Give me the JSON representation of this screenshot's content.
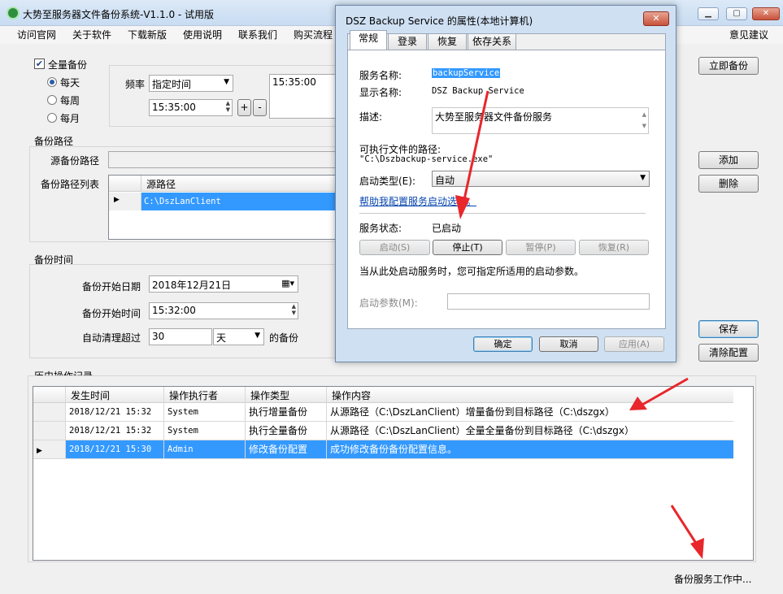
{
  "window": {
    "title": "大势至服务器文件备份系统-V1.1.0 - 试用版",
    "controls": {
      "minimize": "▁",
      "maximize": "▢",
      "close": "✕"
    }
  },
  "menu": {
    "items": [
      "访问官网",
      "关于软件",
      "下载新版",
      "使用说明",
      "联系我们",
      "购买流程"
    ],
    "feedback": "意见建议"
  },
  "schedule": {
    "full_backup_label": "全量备份",
    "full_backup_checked": true,
    "options": [
      "每天",
      "每周",
      "每月"
    ],
    "selected_option": "每天",
    "freq_label": "频率",
    "freq_value": "指定时间",
    "time_value": "15:35:00",
    "plus": "+",
    "minus": "-",
    "times_list": [
      "15:35:00"
    ]
  },
  "paths": {
    "section_label": "备份路径",
    "source_label": "源备份路径",
    "source_value": "",
    "list_label": "备份路径列表",
    "col_header": "源路径",
    "rows": [
      "C:\\DszLanClient"
    ]
  },
  "backup_time": {
    "section_label": "备份时间",
    "start_date_label": "备份开始日期",
    "start_date_value": "2018年12月21日",
    "start_time_label": "备份开始时间",
    "start_time_value": "15:32:00",
    "cleanup_label": "自动清理超过",
    "cleanup_value": "30",
    "cleanup_unit": "天",
    "cleanup_suffix": "的备份"
  },
  "buttons": {
    "backup_now": "立即备份",
    "add": "添加",
    "delete": "删除",
    "save": "保存",
    "clear_config": "清除配置"
  },
  "history": {
    "section_label": "历史操作记录",
    "columns": [
      "发生时间",
      "操作执行者",
      "操作类型",
      "操作内容"
    ],
    "rows": [
      {
        "time": "2018/12/21 15:32",
        "user": "System",
        "type": "执行增量备份",
        "content": "从源路径（C:\\DszLanClient）增量备份到目标路径（C:\\dszgx）"
      },
      {
        "time": "2018/12/21 15:32",
        "user": "System",
        "type": "执行全量备份",
        "content": "从源路径（C:\\DszLanClient）全量全量备份到目标路径（C:\\dszgx）"
      },
      {
        "time": "2018/12/21 15:30",
        "user": "Admin",
        "type": "修改备份配置",
        "content": "成功修改备份备份配置信息。"
      }
    ],
    "selected_row": 2
  },
  "status_bar": {
    "text": "备份服务工作中..."
  },
  "dialog": {
    "title": "DSZ Backup Service 的属性(本地计算机)",
    "close": "✕",
    "tabs": [
      "常规",
      "登录",
      "恢复",
      "依存关系"
    ],
    "active_tab": "常规",
    "service_name_label": "服务名称:",
    "service_name_value": "backupService",
    "display_name_label": "显示名称:",
    "display_name_value": "DSZ Backup Service",
    "description_label": "描述:",
    "description_value": "大势至服务器文件备份服务",
    "exe_path_label": "可执行文件的路径:",
    "exe_path_value": "\"C:\\Dszbackup-service.exe\"",
    "startup_type_label": "启动类型(E):",
    "startup_type_value": "自动",
    "help_link": "帮助我配置服务启动选项。",
    "status_label": "服务状态:",
    "status_value": "已启动",
    "btn_start": "启动(S)",
    "btn_stop": "停止(T)",
    "btn_pause": "暂停(P)",
    "btn_resume": "恢复(R)",
    "hint": "当从此处启动服务时，您可指定所适用的启动参数。",
    "params_label": "启动参数(M):",
    "params_value": "",
    "ok": "确定",
    "cancel": "取消",
    "apply": "应用(A)"
  },
  "colors": {
    "selection": "#3399ff",
    "annotation_arrow": "#e8262b",
    "link": "#0645ad"
  }
}
